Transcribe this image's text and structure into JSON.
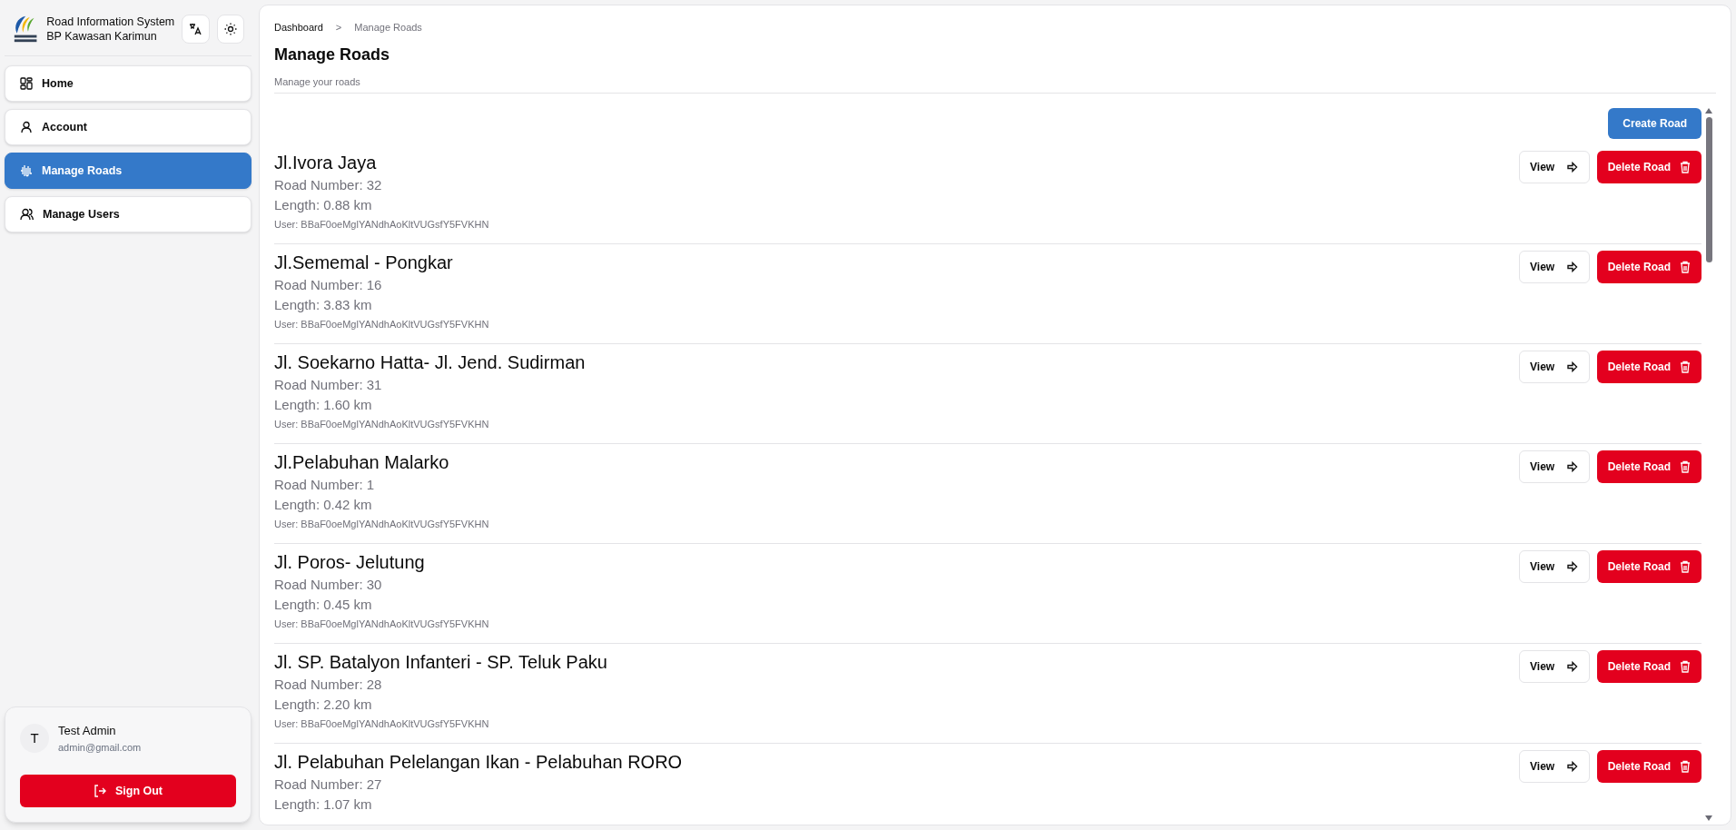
{
  "app": {
    "title_line_1": "Road Information System",
    "title_line_2": "BP Kawasan Karimun"
  },
  "sidebar": {
    "items": [
      {
        "label": "Home",
        "selected": false
      },
      {
        "label": "Account",
        "selected": false
      },
      {
        "label": "Manage Roads",
        "selected": true
      },
      {
        "label": "Manage Users",
        "selected": false
      }
    ]
  },
  "user_card": {
    "initial": "T",
    "name": "Test Admin",
    "email": "admin@gmail.com",
    "sign_out": "Sign Out"
  },
  "breadcrumb": [
    {
      "label": "Dashboard",
      "current": false
    },
    {
      "label": "Manage Roads",
      "current": true
    }
  ],
  "breadcrumb_separator": ">",
  "page": {
    "title": "Manage Roads",
    "subtitle": "Manage your roads",
    "create_button": "Create Road"
  },
  "roads": [
    {
      "name": "Jl.Ivora Jaya",
      "road_number": "Road Number: 32",
      "length": "Length: 0.88 km",
      "user": "User: BBaF0oeMglYANdhAoKltVUGsfY5FVKHN",
      "view": "View",
      "delete": "Delete Road"
    },
    {
      "name": "Jl.Sememal - Pongkar",
      "road_number": "Road Number: 16",
      "length": "Length: 3.83 km",
      "user": "User: BBaF0oeMglYANdhAoKltVUGsfY5FVKHN",
      "view": "View",
      "delete": "Delete Road"
    },
    {
      "name": "Jl. Soekarno Hatta- Jl. Jend. Sudirman",
      "road_number": "Road Number: 31",
      "length": "Length: 1.60 km",
      "user": "User: BBaF0oeMglYANdhAoKltVUGsfY5FVKHN",
      "view": "View",
      "delete": "Delete Road"
    },
    {
      "name": "Jl.Pelabuhan Malarko",
      "road_number": "Road Number: 1",
      "length": "Length: 0.42 km",
      "user": "User: BBaF0oeMglYANdhAoKltVUGsfY5FVKHN",
      "view": "View",
      "delete": "Delete Road"
    },
    {
      "name": "Jl. Poros- Jelutung",
      "road_number": "Road Number: 30",
      "length": "Length: 0.45 km",
      "user": "User: BBaF0oeMglYANdhAoKltVUGsfY5FVKHN",
      "view": "View",
      "delete": "Delete Road"
    },
    {
      "name": "Jl. SP. Batalyon Infanteri - SP. Teluk Paku",
      "road_number": "Road Number: 28",
      "length": "Length: 2.20 km",
      "user": "User: BBaF0oeMglYANdhAoKltVUGsfY5FVKHN",
      "view": "View",
      "delete": "Delete Road"
    },
    {
      "name": "Jl. Pelabuhan Pelelangan Ikan - Pelabuhan RORO",
      "road_number": "Road Number: 27",
      "length": "Length: 1.07 km",
      "view": "View",
      "delete": "Delete Road"
    }
  ]
}
